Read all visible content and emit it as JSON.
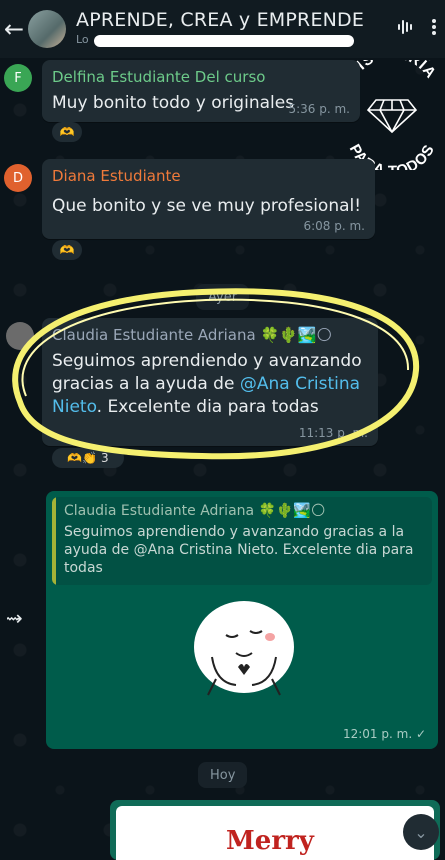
{
  "header": {
    "back_icon": "arrow-left-icon",
    "title": "APRENDE, CREA y EMPRENDE",
    "subtitle": "Lo",
    "voice_icon": "voice-wave-icon",
    "menu_icon": "more-vertical-icon"
  },
  "logo": {
    "line1": "BISUTERÍA",
    "line2": "PARA TODOS"
  },
  "messages": [
    {
      "avatar": "F",
      "sender": "Delfina Estudiante Del curso",
      "sender_color": "#6dcb8a",
      "text": "Muy bonito todo y originales",
      "time": "5:36 p. m.",
      "reaction": "heart-hands"
    },
    {
      "avatar": "D",
      "sender": "Diana Estudiante",
      "sender_color": "#f07a3a",
      "text": "Que bonito y se ve muy profesional!",
      "time": "6:08 p. m.",
      "reaction": "heart-hands"
    }
  ],
  "day_separators": {
    "yesterday": "Ayer",
    "today": "Hoy"
  },
  "highlighted_message": {
    "sender": "Claudia Estudiante Adriana",
    "sender_emojis": "🍀🌵🏞️🌕",
    "text_before": "Seguimos aprendiendo y avanzando gracias a la ayuda de ",
    "mention": "@Ana Cristina Nieto",
    "text_after": ". Excelente dia para todas",
    "time": "11:13 p. m.",
    "reaction_count": "3"
  },
  "outgoing": {
    "quote_sender": "Claudia Estudiante Adriana 🍀🌵🏞️🌕",
    "quote_text": "Seguimos aprendiendo y avanzando gracias a la ayuda de @Ana Cristina Nieto. Excelente dia para todas",
    "time": "12:01 p. m. ✓",
    "sticker": "cute-blob-heart-sticker"
  },
  "bottom_card": {
    "partial_text": "Merry"
  },
  "colors": {
    "highlight_ring": "#f5f070",
    "outgoing_bubble": "#005c4b",
    "incoming_bubble": "#202c33",
    "mention": "#53bdeb"
  }
}
